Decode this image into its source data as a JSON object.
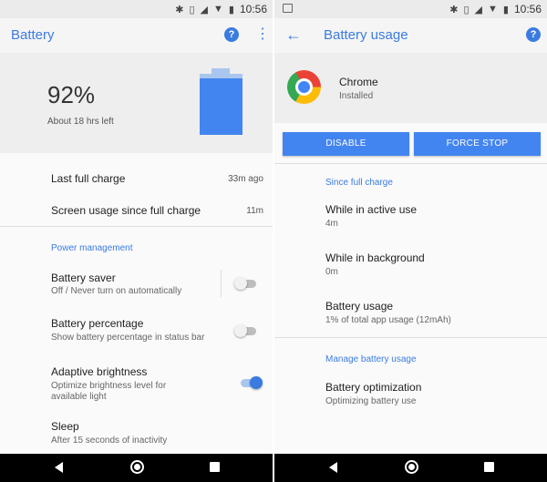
{
  "left": {
    "status_time": "10:56",
    "title": "Battery",
    "help_glyph": "?",
    "more_glyph": "⋮",
    "battery_percent": "92%",
    "time_left": "About 18 hrs left",
    "battery_level": 0.92,
    "rows": {
      "last_full_charge": {
        "label": "Last full charge",
        "value": "33m ago"
      },
      "screen_usage": {
        "label": "Screen usage since full charge",
        "value": "11m"
      }
    },
    "section_power": "Power management",
    "battery_saver": {
      "title": "Battery saver",
      "subtitle": "Off / Never turn on automatically",
      "enabled": false
    },
    "battery_percentage": {
      "title": "Battery percentage",
      "subtitle": "Show battery percentage in status bar",
      "enabled": false
    },
    "adaptive_brightness": {
      "title": "Adaptive brightness",
      "subtitle_line1": "Optimize brightness level for",
      "subtitle_line2": "available light",
      "enabled": true
    },
    "sleep": {
      "title": "Sleep",
      "subtitle": "After 15 seconds of inactivity"
    }
  },
  "right": {
    "status_time": "10:56",
    "title": "Battery usage",
    "back_glyph": "←",
    "help_glyph": "?",
    "app_name": "Chrome",
    "app_status": "Installed",
    "disable_label": "DISABLE",
    "force_stop_label": "FORCE STOP",
    "section_since": "Since full charge",
    "active_use": {
      "title": "While in active use",
      "value": "4m"
    },
    "background": {
      "title": "While in background",
      "value": "0m"
    },
    "battery_usage": {
      "title": "Battery usage",
      "value": "1% of total app usage (12mAh)"
    },
    "section_manage": "Manage battery usage",
    "optimization": {
      "title": "Battery optimization",
      "value": "Optimizing battery use"
    }
  },
  "icons": [
    "bluetooth-icon",
    "vibrate-icon",
    "signal-icon",
    "wifi-icon",
    "battery-icon",
    "image-icon",
    "back-arrow-icon",
    "help-icon",
    "more-icon",
    "chrome-logo-icon"
  ],
  "colors": {
    "accent": "#3b7be0",
    "battery_fill": "#4385f0",
    "button": "#4385f0"
  }
}
